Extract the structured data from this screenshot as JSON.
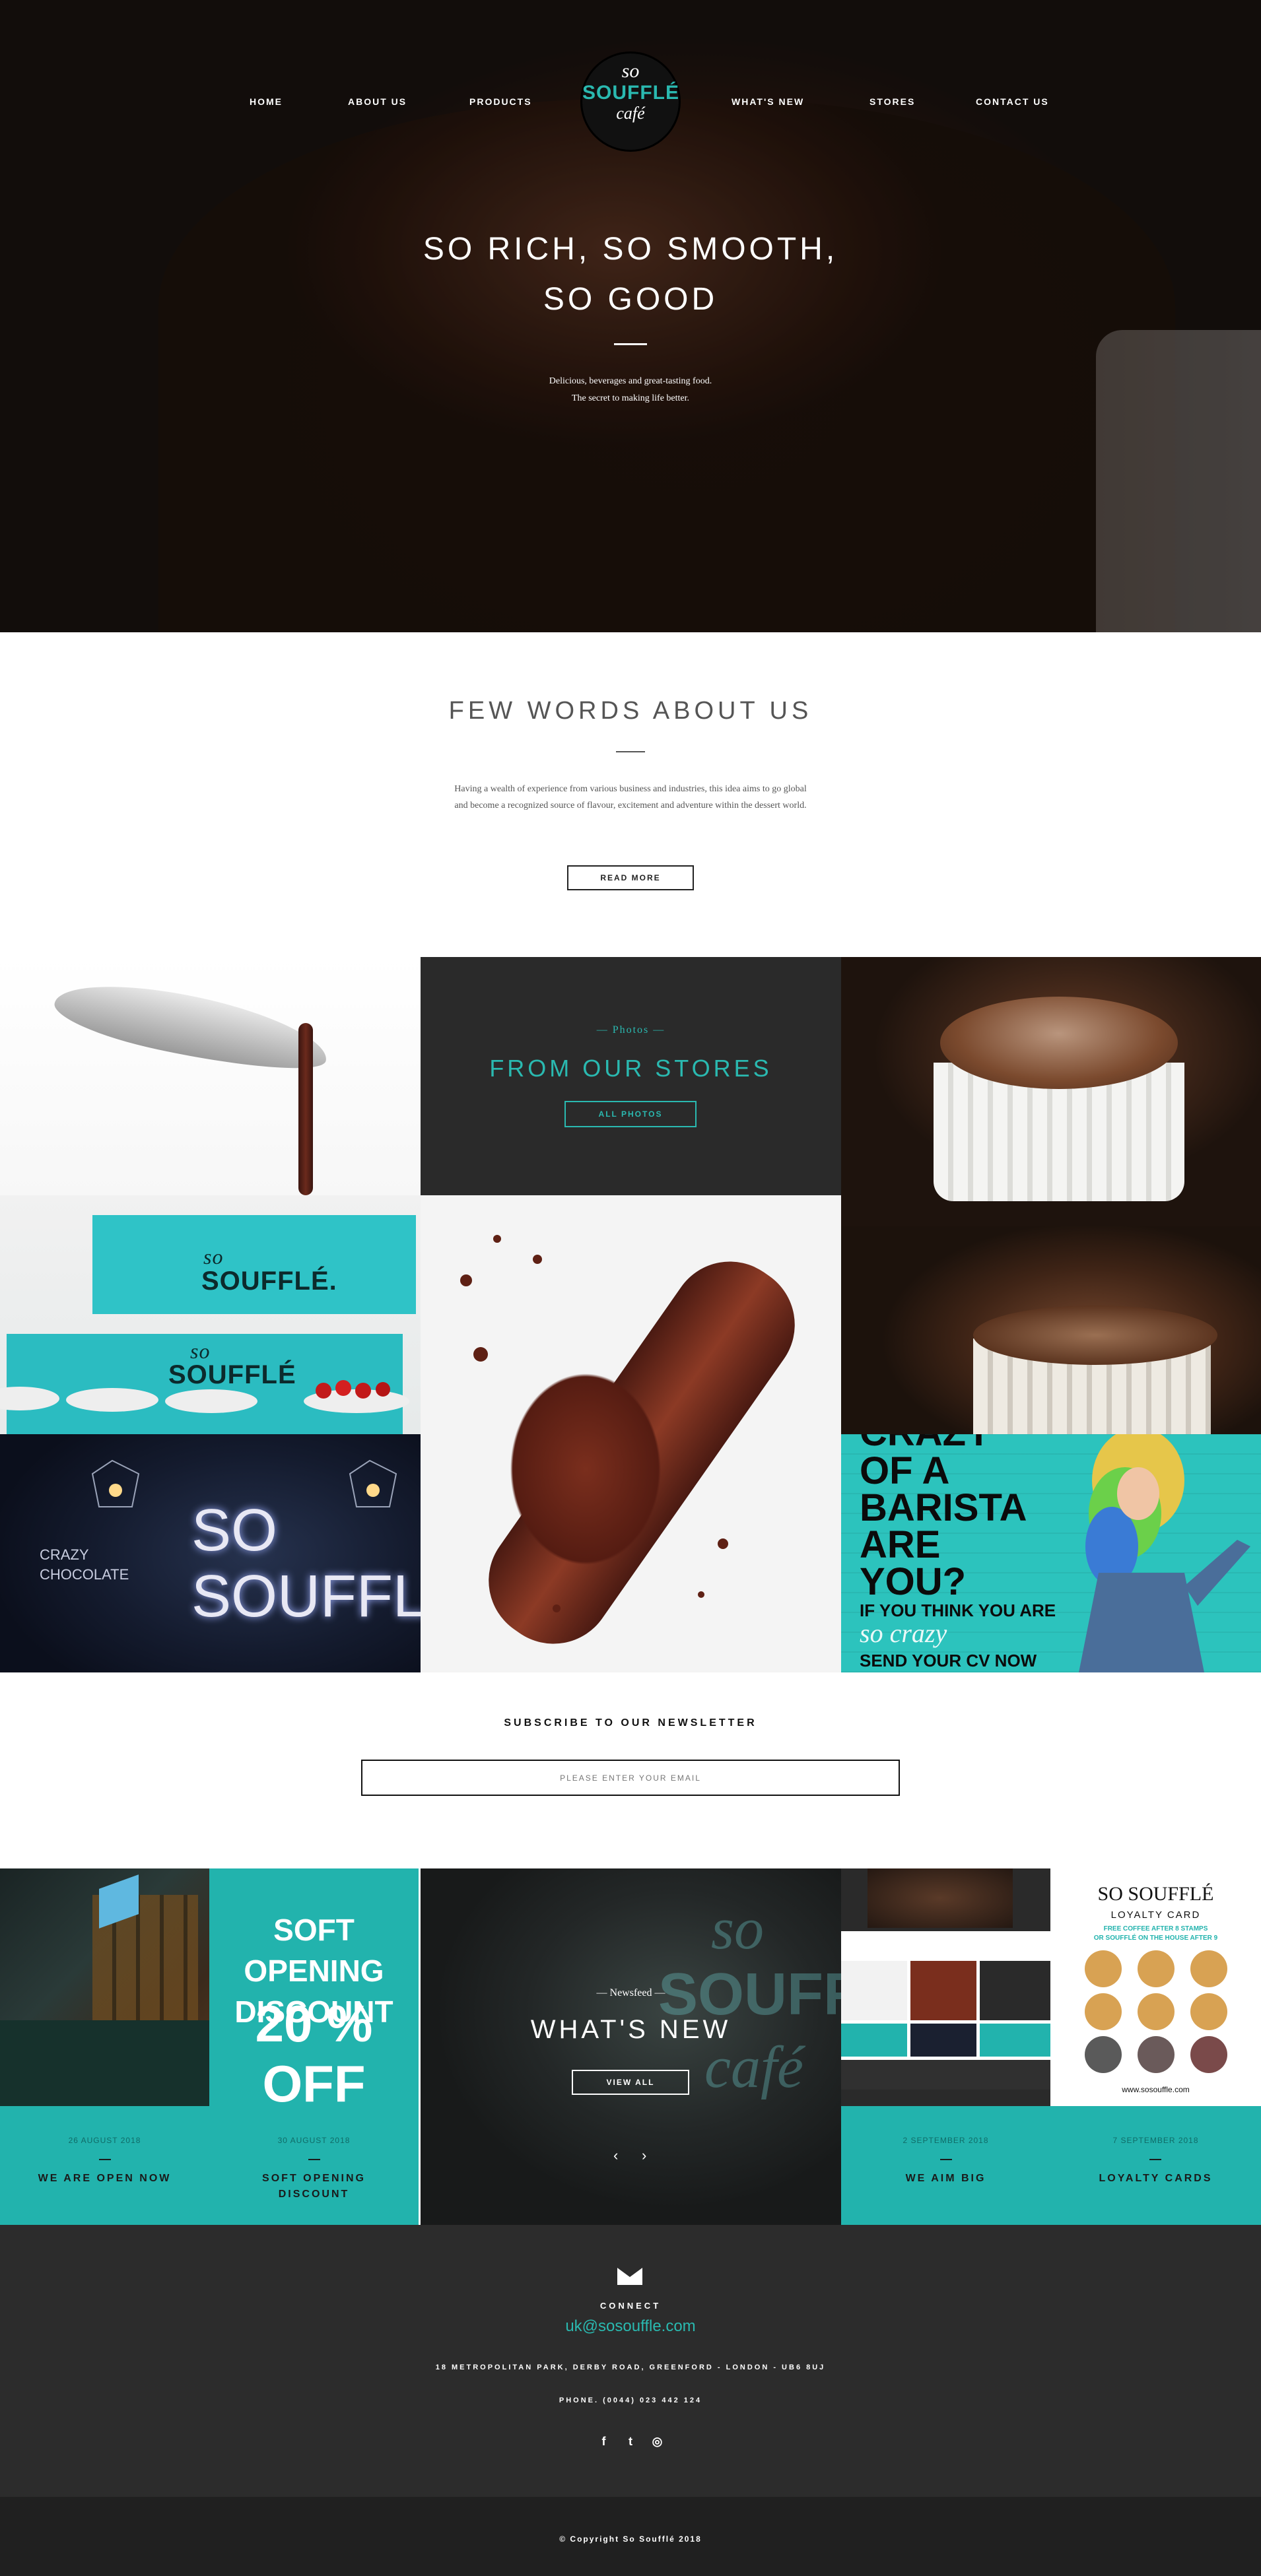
{
  "nav": {
    "items": [
      "HOME",
      "ABOUT US",
      "PRODUCTS",
      "WHAT'S NEW",
      "STORES",
      "CONTACT US"
    ],
    "logo": {
      "line1": "so",
      "line2": "SOUFFLÉ",
      "line3": "café"
    }
  },
  "hero": {
    "title_line1": "SO RICH, SO SMOOTH,",
    "title_line2": "SO GOOD",
    "sub_line1": "Delicious, beverages and great-tasting food.",
    "sub_line2": "The secret to making life better."
  },
  "about": {
    "heading": "FEW WORDS ABOUT US",
    "body": "Having a wealth of experience from various business and industries, this idea aims to go global and become a recognized source of flavour, excitement and adventure within the dessert world.",
    "button": "READ MORE"
  },
  "gallery": {
    "stores_tag": "— Photos —",
    "stores_heading": "FROM OUR STORES",
    "stores_button": "ALL PHOTOS",
    "box_label1": "so",
    "box_label2": "SOUFFLÉ.",
    "box_label3": "so",
    "box_label4": "SOUFFLÉ",
    "sign_line1": "SO",
    "sign_line2": "SOUFFLé",
    "sign_menu1": "CRAZY",
    "sign_menu2": "CHOCOLATE",
    "barista_lines": [
      "CRAZY",
      "OF A",
      "BARISTA",
      "ARE",
      "YOU?"
    ],
    "barista_if": "IF YOU THINK YOU ARE",
    "barista_crazy": "so crazy",
    "barista_cv": "SEND YOUR CV NOW"
  },
  "newsletter": {
    "heading": "SUBSCRIBE TO OUR NEWSLETTER",
    "placeholder": "PLEASE ENTER YOUR EMAIL"
  },
  "news": {
    "tag": "— Newsfeed —",
    "heading": "WHAT'S NEW",
    "button": "VIEW ALL",
    "prev": "‹",
    "next": "›",
    "ghost1": "so",
    "ghost2": "SOUFFLÉ",
    "ghost3": "café",
    "cards": [
      {
        "date": "26 AUGUST 2018",
        "title": "WE ARE OPEN NOW"
      },
      {
        "date": "30 AUGUST 2018",
        "title_line1": "SOFT OPENING",
        "title_line2": "DISCOUNT",
        "promo_line1": "SOFT OPENING",
        "promo_line2": "DISCOUNT",
        "promo_line3": "20 % OFF"
      },
      {
        "date": "2 SEPTEMBER 2018",
        "title": "WE AIM BIG"
      },
      {
        "date": "7 SEPTEMBER 2018",
        "title": "LOYALTY CARDS",
        "card_title": "SO SOUFFLÉ",
        "card_sub": "LOYALTY CARD",
        "card_line1": "FREE COFFEE AFTER 8 STAMPS",
        "card_line2": "OR SOUFFLÉ ON THE HOUSE AFTER 9",
        "card_url": "www.sosouffle.com"
      }
    ]
  },
  "footer": {
    "connect": "CONNECT",
    "email": "uk@sosouffle.com",
    "address": "18 METROPOLITAN PARK, DERBY ROAD, GREENFORD - LONDON - UB6 8UJ",
    "phone": "PHONE. (0044) 023 442 124",
    "social": [
      "f",
      "t",
      "◎"
    ],
    "copyright": "© Copyright So Soufflé 2018"
  },
  "colors": {
    "accent": "#2ab9b0",
    "dark": "#2c2c2c"
  }
}
